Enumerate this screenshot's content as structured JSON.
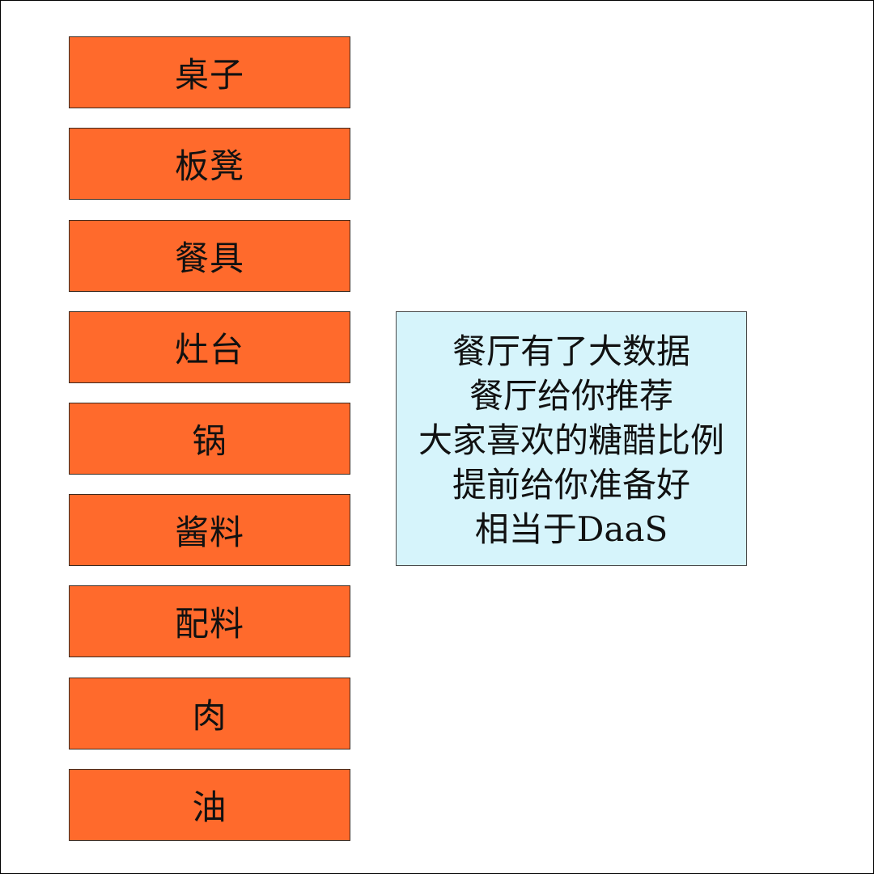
{
  "ingredients": [
    "桌子",
    "板凳",
    "餐具",
    "灶台",
    "锅",
    "酱料",
    "配料",
    "肉",
    "油"
  ],
  "info": {
    "lines": [
      "餐厅有了大数据",
      "餐厅给你推荐",
      "大家喜欢的糖醋比例",
      "提前给你准备好",
      "相当于DaaS"
    ]
  },
  "colors": {
    "box_fill": "#ff6a2c",
    "info_fill": "#d6f4fb"
  }
}
